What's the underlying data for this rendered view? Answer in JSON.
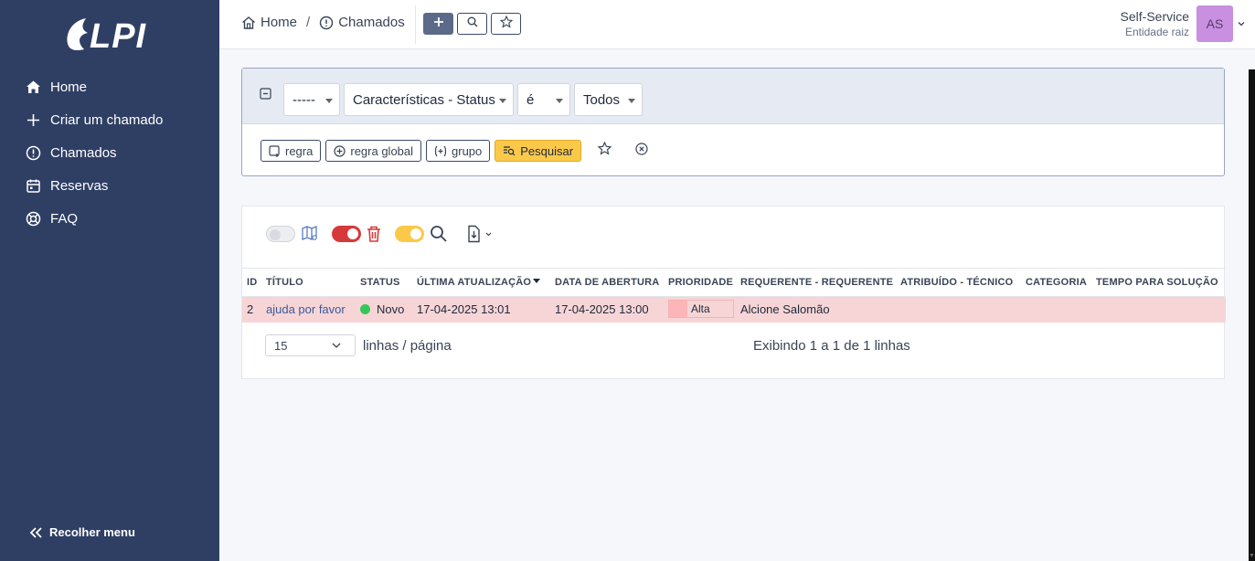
{
  "sidebar": {
    "logo_text": "GLPI",
    "items": [
      {
        "label": "Home",
        "icon": "home-icon"
      },
      {
        "label": "Criar um chamado",
        "icon": "plus-icon"
      },
      {
        "label": "Chamados",
        "icon": "alert-circle-icon"
      },
      {
        "label": "Reservas",
        "icon": "calendar-icon"
      },
      {
        "label": "FAQ",
        "icon": "lifebuoy-icon"
      }
    ],
    "collapse_label": "Recolher menu"
  },
  "header": {
    "breadcrumb": [
      {
        "label": "Home",
        "icon": "home-icon"
      },
      {
        "label": "Chamados",
        "icon": "alert-circle-icon"
      }
    ],
    "breadcrumb_separator": "/",
    "actions": [
      "plus-icon",
      "search-icon",
      "star-icon"
    ],
    "user": {
      "name": "Self-Service",
      "entity": "Entidade raiz",
      "initials": "AS",
      "avatar_color": "#c98fe0"
    }
  },
  "criteria": {
    "link_select": "-----",
    "field_select": "Características - Status",
    "operator_select": "é",
    "value_select": "Todos",
    "buttons": {
      "rule": "regra",
      "global_rule": "regra global",
      "group": "grupo",
      "search": "Pesquisar"
    }
  },
  "results": {
    "columns": [
      "ID",
      "TÍTULO",
      "STATUS",
      "ÚLTIMA ATUALIZAÇÃO",
      "DATA DE ABERTURA",
      "PRIORIDADE",
      "REQUERENTE - REQUERENTE",
      "ATRIBUÍDO - TÉCNICO",
      "CATEGORIA",
      "TEMPO PARA SOLUÇÃO"
    ],
    "sorted_column": "ÚLTIMA ATUALIZAÇÃO",
    "rows": [
      {
        "id": "2",
        "title": "ajuda por favor",
        "status": "Novo",
        "last_update": "17-04-2025 13:01",
        "opened": "17-04-2025 13:00",
        "priority": "Alta",
        "requester": "Alcione Salomão",
        "technician": "",
        "category": "",
        "solve_time": ""
      }
    ],
    "per_page": "15",
    "per_page_label": "linhas / página",
    "showing": "Exibindo 1 a 1 de 1 linhas"
  },
  "colors": {
    "sidebar_bg": "#2f3f64",
    "search_button": "#fbc94a",
    "row_high_priority": "#f7d5d7",
    "status_new": "#34c759",
    "toggle_red": "#d63939",
    "toggle_yellow": "#fbc94a"
  }
}
